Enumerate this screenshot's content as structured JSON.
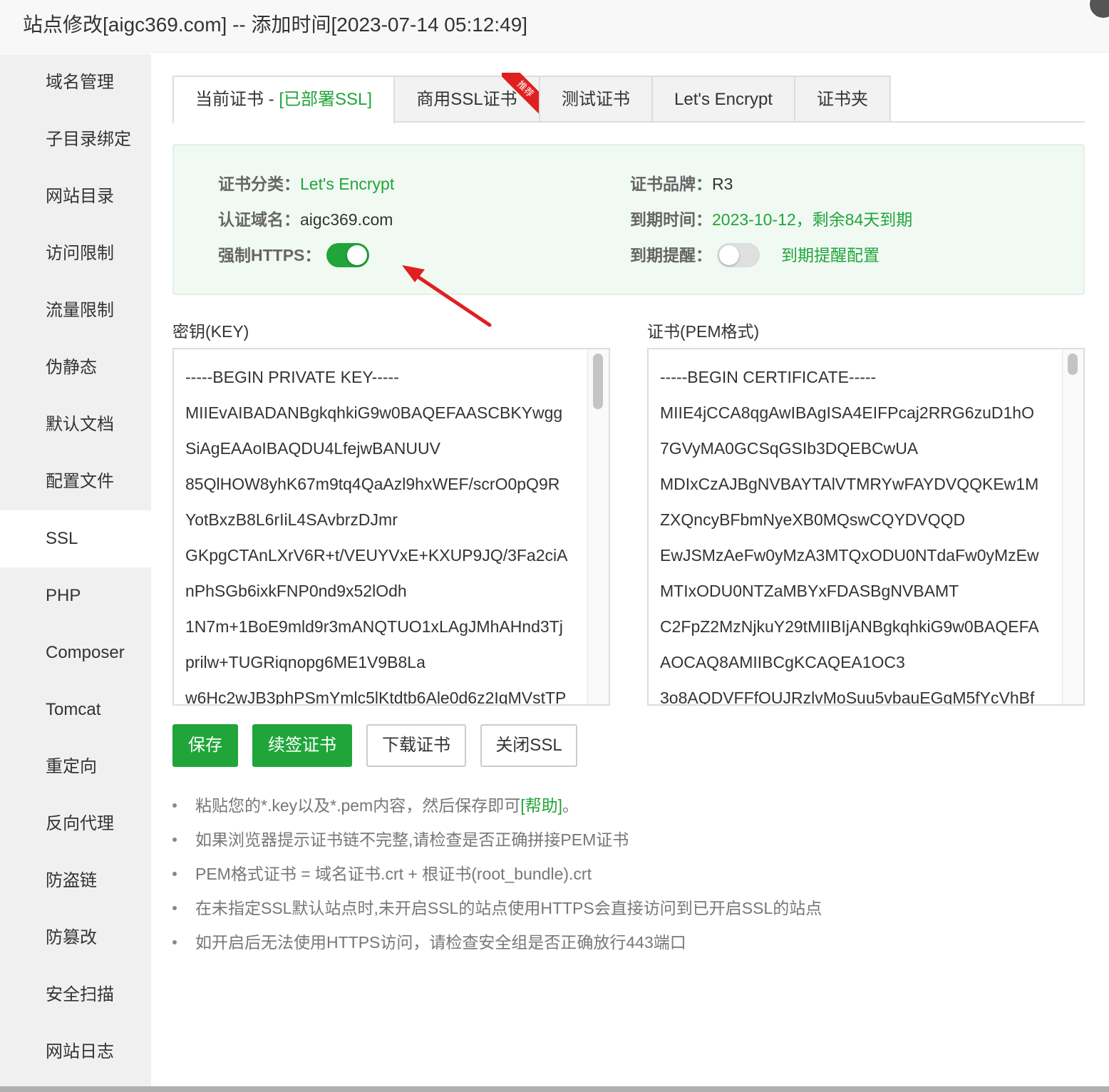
{
  "window": {
    "title": "站点修改[aigc369.com] -- 添加时间[2023-07-14 05:12:49]"
  },
  "sidebar": {
    "items": [
      {
        "label": "域名管理"
      },
      {
        "label": "子目录绑定"
      },
      {
        "label": "网站目录"
      },
      {
        "label": "访问限制"
      },
      {
        "label": "流量限制"
      },
      {
        "label": "伪静态"
      },
      {
        "label": "默认文档"
      },
      {
        "label": "配置文件"
      },
      {
        "label": "SSL",
        "active": true
      },
      {
        "label": "PHP"
      },
      {
        "label": "Composer"
      },
      {
        "label": "Tomcat"
      },
      {
        "label": "重定向"
      },
      {
        "label": "反向代理"
      },
      {
        "label": "防盗链"
      },
      {
        "label": "防篡改"
      },
      {
        "label": "安全扫描"
      },
      {
        "label": "网站日志"
      }
    ]
  },
  "tabs": {
    "current_prefix": "当前证书 - ",
    "current_status": "[已部署SSL]",
    "commercial": "商用SSL证书",
    "commercial_badge": "推荐",
    "test": "测试证书",
    "letsencrypt": "Let's Encrypt",
    "folder": "证书夹"
  },
  "cert_info": {
    "category_label": "证书分类：",
    "category_value": "Let's Encrypt",
    "brand_label": "证书品牌：",
    "brand_value": "R3",
    "domain_label": "认证域名：",
    "domain_value": "aigc369.com",
    "expire_label": "到期时间：",
    "expire_value": "2023-10-12，剩余84天到期",
    "force_https_label": "强制HTTPS：",
    "force_https_on": true,
    "reminder_label": "到期提醒：",
    "reminder_on": false,
    "reminder_config_link": "到期提醒配置"
  },
  "key_field": {
    "label": "密钥(KEY)",
    "lines": [
      "-----BEGIN PRIVATE KEY-----",
      "MIIEvAIBADANBgkqhkiG9w0BAQEFAASCBKYwgg",
      "SiAgEAAoIBAQDU4LfejwBANUUV",
      "85QlHOW8yhK67m9tq4QaAzl9hxWEF/scrO0pQ9R",
      "YotBxzB8L6rIiL4SAvbrzDJmr",
      "GKpgCTAnLXrV6R+t/VEUYVxE+KXUP9JQ/3Fa2ciA",
      "nPhSGb6ixkFNP0nd9x52lOdh",
      "1N7m+1BoE9mld9r3mANQTUO1xLAgJMhAHnd3Tj",
      "prilw+TUGRiqnopg6ME1V9B8La",
      "w6Hc2wJB3phPSmYmlc5lKtdtb6Ale0d6z2IqMVstTP"
    ]
  },
  "cert_field": {
    "label": "证书(PEM格式)",
    "lines": [
      "-----BEGIN CERTIFICATE-----",
      "MIIE4jCCA8qgAwIBAgISA4EIFPcaj2RRG6zuD1hO",
      "7GVyMA0GCSqGSIb3DQEBCwUA",
      "MDIxCzAJBgNVBAYTAlVTMRYwFAYDVQQKEw1M",
      "ZXQncyBFbmNyeXB0MQswCQYDVQQD",
      "EwJSMzAeFw0yMzA3MTQxODU0NTdaFw0yMzEw",
      "MTIxODU0NTZaMBYxFDASBgNVBAMT",
      "C2FpZ2MzNjkuY29tMIIBIjANBgkqhkiG9w0BAQEFA",
      "AOCAQ8AMIIBCgKCAQEA1OC3",
      "3o8AQDVFFfOUJRzlvMoSuu5vbauEGgM5fYcVhBf"
    ]
  },
  "buttons": {
    "save": "保存",
    "renew": "续签证书",
    "download": "下载证书",
    "close_ssl": "关闭SSL"
  },
  "tips": {
    "tip1_text": "粘贴您的*.key以及*.pem内容，然后保存即可",
    "tip1_help": "[帮助]",
    "tip1_end": "。",
    "tip2": "如果浏览器提示证书链不完整,请检查是否正确拼接PEM证书",
    "tip3": "PEM格式证书 = 域名证书.crt + 根证书(root_bundle).crt",
    "tip4": "在未指定SSL默认站点时,未开启SSL的站点使用HTTPS会直接访问到已开启SSL的站点",
    "tip5": "如开启后无法使用HTTPS访问，请检查安全组是否正确放行443端口"
  },
  "colors": {
    "accent": "#20a53a",
    "arrow": "#e02020"
  }
}
